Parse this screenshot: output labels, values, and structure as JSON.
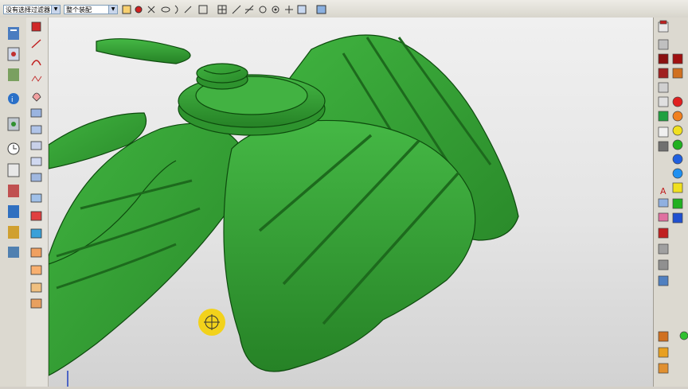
{
  "toolbar": {
    "selection_filter": "没有选择过滤器",
    "assembly_scope": "整个装配"
  },
  "colors": {
    "model_green": "#2f9a2f",
    "model_edge": "#0d4a0d",
    "viewport_top": "#f0f0f0",
    "viewport_bottom": "#d2d2d2",
    "snap_marker": "#f2d21b"
  },
  "left_icons": [
    "sketch-icon",
    "line-icon",
    "arc-icon",
    "spline-icon",
    "extrude-icon",
    "revolve-icon",
    "hole-icon",
    "blend-icon",
    "chamfer-icon",
    "shell-icon",
    "history-icon",
    "roles-icon",
    "parts-navigator-icon",
    "assembly-navigator-icon",
    "web-browser-icon"
  ],
  "right_colors": [
    "#e02020",
    "#f08020",
    "#f0e020",
    "#20b020",
    "#2060e0",
    "#20a0f0",
    "#e02020",
    "#20c020"
  ]
}
